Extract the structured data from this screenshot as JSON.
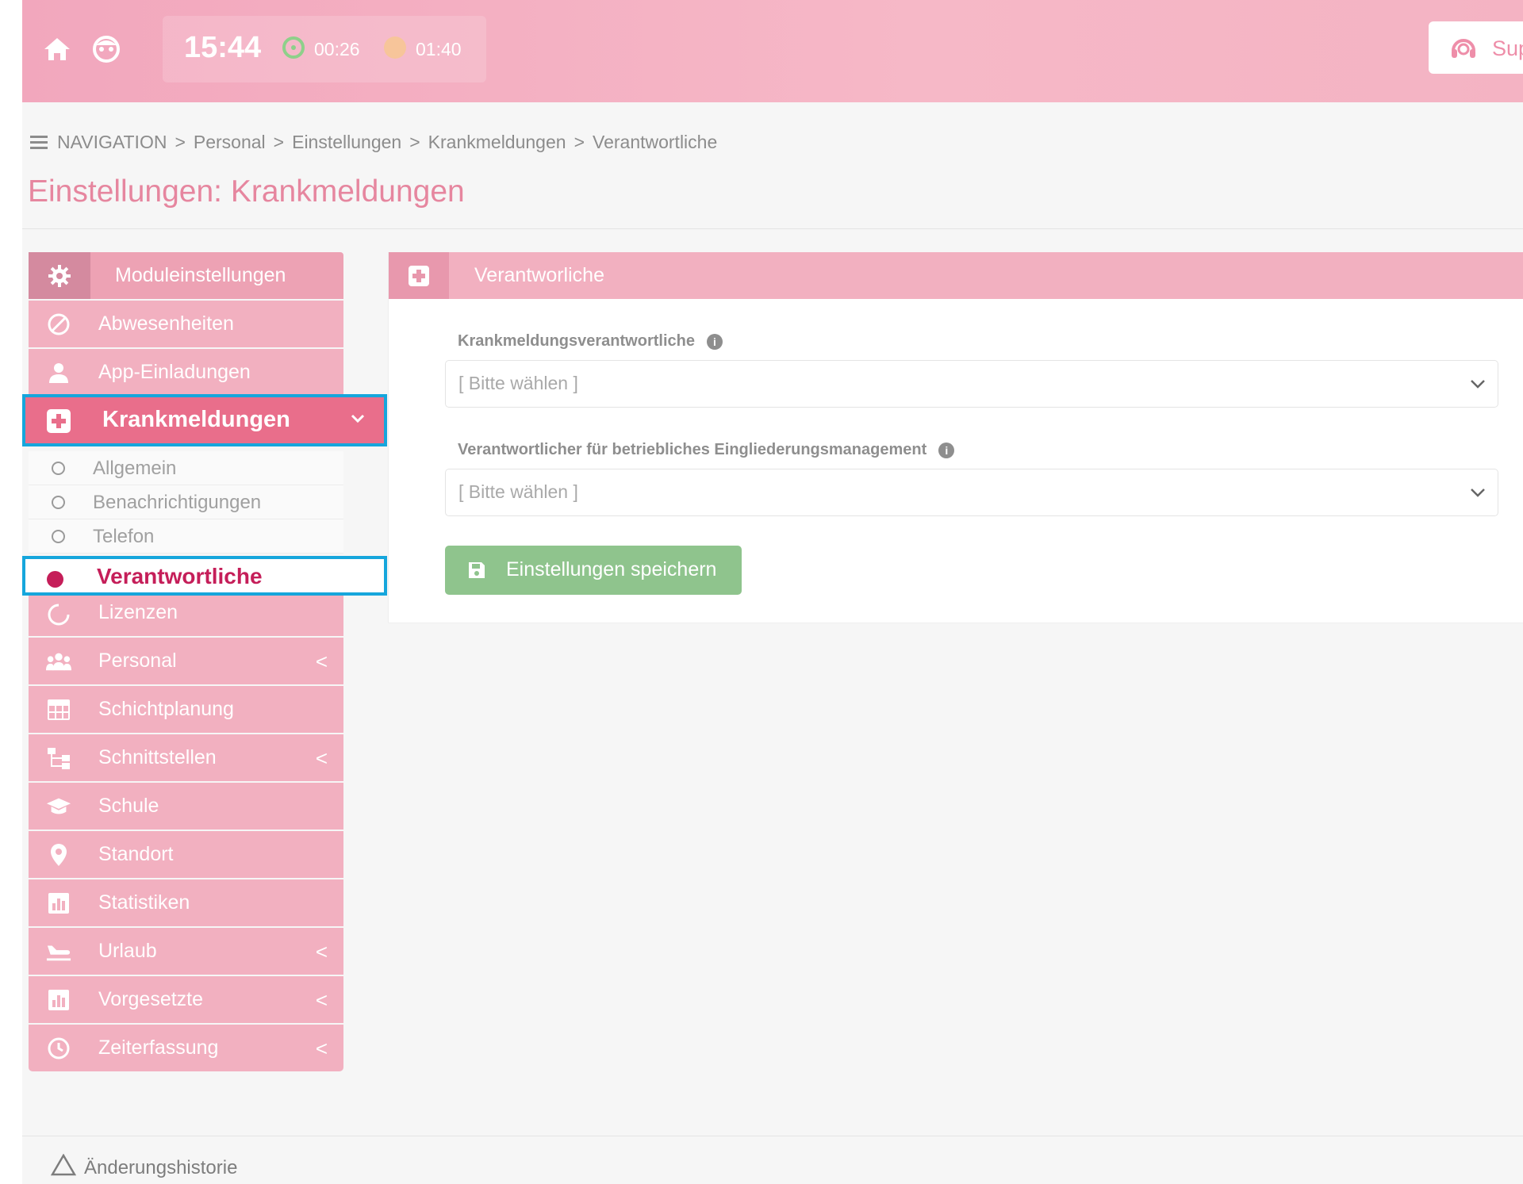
{
  "topbar": {
    "clock": "15:44",
    "timer_running": "00:26",
    "timer_pause": "01:40",
    "support_label": "Support",
    "icons": [
      "home-icon",
      "user-face-icon",
      "headset-icon"
    ]
  },
  "breadcrumb": {
    "items": [
      "NAVIGATION",
      "Personal",
      "Einstellungen",
      "Krankmeldungen",
      "Verantwortliche"
    ],
    "separator": ">"
  },
  "page": {
    "title": "Einstellungen: Krankmeldungen"
  },
  "sidebar": {
    "header": "Moduleinstellungen",
    "items_before": [
      {
        "label": "Abwesenheiten",
        "icon": "ban-icon"
      },
      {
        "label": "App-Einladungen",
        "icon": "user-icon"
      }
    ],
    "active": {
      "label": "Krankmeldungen",
      "icon": "medical-plus-icon"
    },
    "sub_items": [
      {
        "label": "Allgemein"
      },
      {
        "label": "Benachrichtigungen"
      },
      {
        "label": "Telefon"
      }
    ],
    "sub_active": {
      "label": "Verantwortliche"
    },
    "items_after": [
      {
        "label": "Lizenzen",
        "icon": "circle-notch-icon",
        "chevron": ""
      },
      {
        "label": "Personal",
        "icon": "users-icon",
        "chevron": "<"
      },
      {
        "label": "Schichtplanung",
        "icon": "table-icon",
        "chevron": ""
      },
      {
        "label": "Schnittstellen",
        "icon": "sitemap-icon",
        "chevron": "<"
      },
      {
        "label": "Schule",
        "icon": "graduation-cap-icon",
        "chevron": ""
      },
      {
        "label": "Standort",
        "icon": "map-marker-icon",
        "chevron": ""
      },
      {
        "label": "Statistiken",
        "icon": "chart-icon",
        "chevron": ""
      },
      {
        "label": "Urlaub",
        "icon": "plane-icon",
        "chevron": "<"
      },
      {
        "label": "Vorgesetzte",
        "icon": "chart-icon",
        "chevron": "<"
      },
      {
        "label": "Zeiterfassung",
        "icon": "clock-icon",
        "chevron": "<"
      }
    ]
  },
  "panel": {
    "title": "Verantworliche",
    "field1": {
      "label": "Krankmeldungsverantwortliche",
      "value": "[ Bitte wählen ]"
    },
    "field2": {
      "label": "Verantwortlicher für betriebliches Eingliederungsmanagement",
      "value": "[ Bitte wählen ]"
    },
    "save_label": "Einstellungen speichern"
  },
  "footer": {
    "label": "Änderungshistorie"
  },
  "colors": {
    "topbar": "#f2a7bd",
    "sidebar_item": "#f2b0c0",
    "active_item": "#e96e8b",
    "highlight_border": "#16a6dc",
    "accent_text": "#c51e59",
    "save_button": "#8fc48d"
  }
}
